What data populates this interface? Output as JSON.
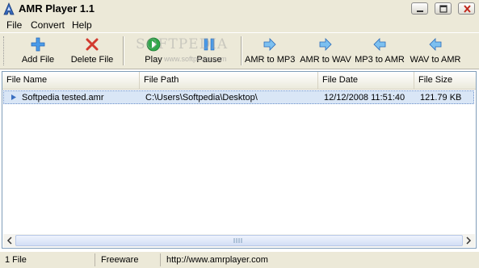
{
  "window": {
    "title": "AMR Player 1.1"
  },
  "menu": [
    {
      "label": "File"
    },
    {
      "label": "Convert"
    },
    {
      "label": "Help"
    }
  ],
  "toolbar": {
    "buttons": [
      {
        "label": "Add File",
        "icon": "plus-icon"
      },
      {
        "label": "Delete File",
        "icon": "x-icon"
      },
      {
        "label": "Play",
        "icon": "play-icon"
      },
      {
        "label": "Pause",
        "icon": "pause-icon"
      },
      {
        "label": "AMR to MP3",
        "icon": "arrow-right-icon"
      },
      {
        "label": "AMR to WAV",
        "icon": "arrow-right-icon"
      },
      {
        "label": "MP3 to AMR",
        "icon": "arrow-left-icon"
      },
      {
        "label": "WAV to AMR",
        "icon": "arrow-left-icon"
      }
    ],
    "watermark": "SOFTPEDIA",
    "watermark_small": "www.softpedia.com"
  },
  "list": {
    "columns": [
      "File Name",
      "File Path",
      "File Date",
      "File Size"
    ],
    "rows": [
      {
        "name": "Softpedia tested.amr",
        "path": "C:\\Users\\Softpedia\\Desktop\\",
        "date": "12/12/2008 11:51:40",
        "size": "121.79 KB"
      }
    ]
  },
  "status": {
    "count": "1 File",
    "license": "Freeware",
    "url": "http://www.amrplayer.com"
  },
  "colors": {
    "accent_blue": "#3b8ee0",
    "delete_red": "#d23a2e",
    "play_green": "#2fa84a",
    "selection": "#d9e6f6"
  }
}
